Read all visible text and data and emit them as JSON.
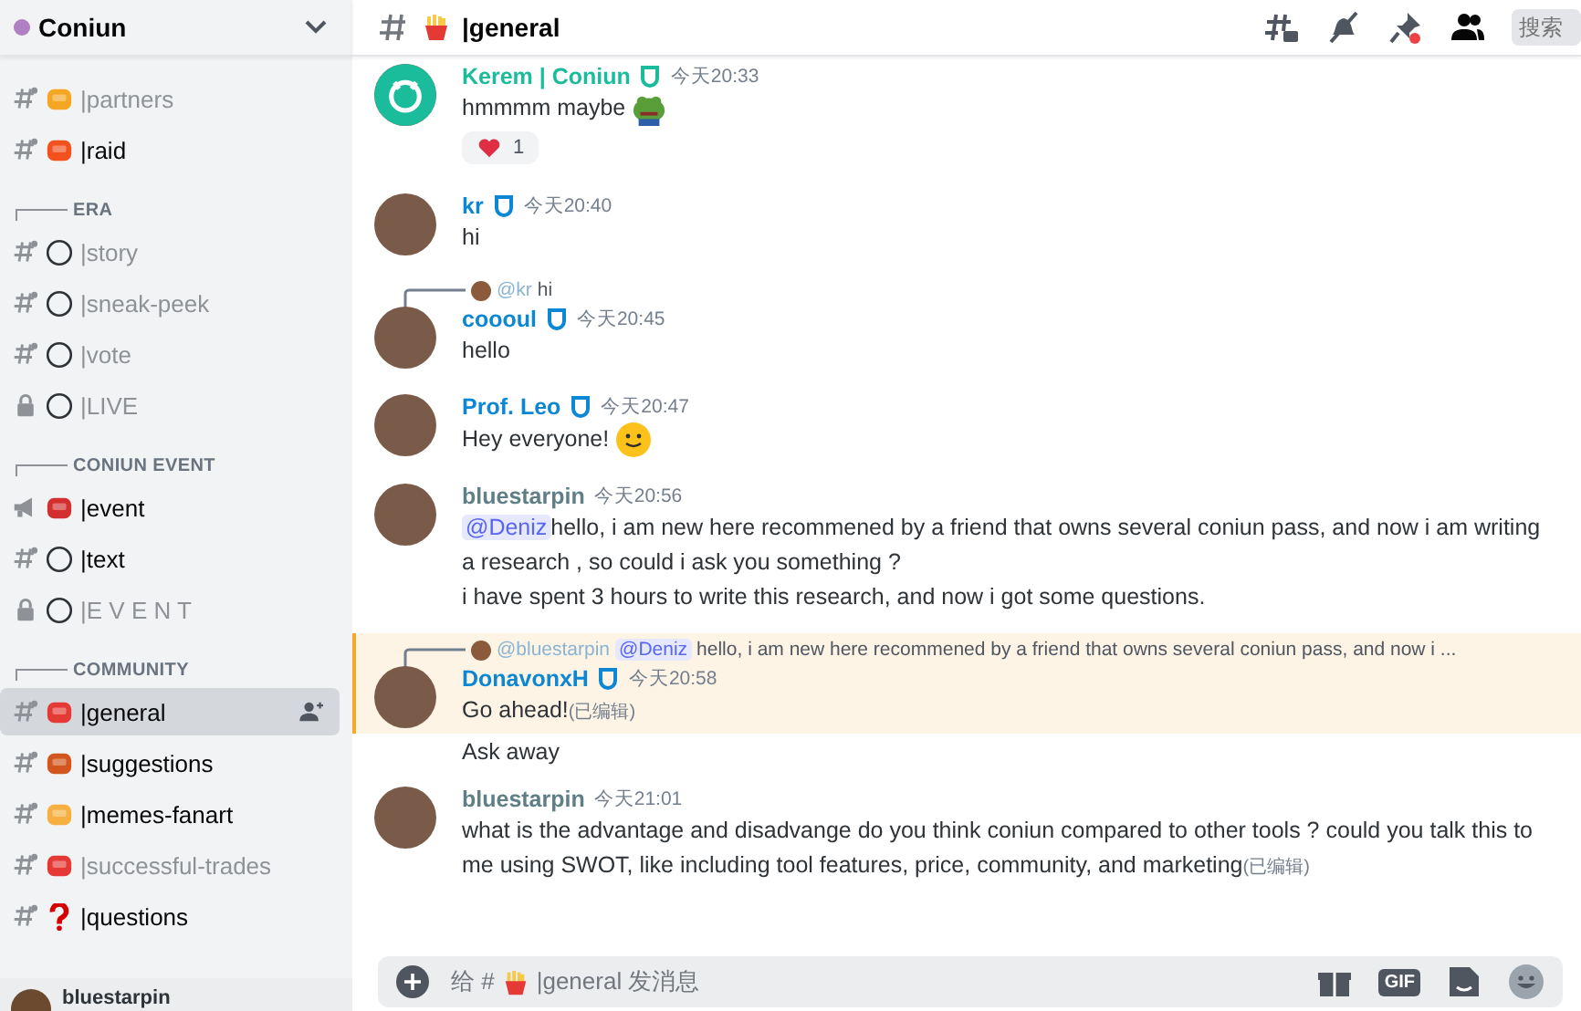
{
  "server": {
    "name": "Coniun"
  },
  "sidebar": {
    "groups": [
      {
        "channels": [
          {
            "kind": "hash",
            "emoji": {
              "kind": "beer"
            },
            "name": "|partners",
            "unread": false,
            "selected": false
          },
          {
            "kind": "hash",
            "emoji": {
              "kind": "fire"
            },
            "name": "|raid",
            "unread": true,
            "selected": false
          }
        ]
      },
      {
        "title": "ERA",
        "expanded": true,
        "channels": [
          {
            "kind": "hash",
            "emoji": {
              "kind": "circle"
            },
            "name": "|story",
            "unread": false,
            "selected": false
          },
          {
            "kind": "hash",
            "emoji": {
              "kind": "circle"
            },
            "name": "|sneak-peek",
            "unread": false,
            "selected": false
          },
          {
            "kind": "hash",
            "emoji": {
              "kind": "circle"
            },
            "name": "|vote",
            "unread": false,
            "selected": false
          },
          {
            "kind": "lock",
            "emoji": {
              "kind": "circle"
            },
            "name": "|LIVE",
            "unread": false,
            "selected": false
          }
        ]
      },
      {
        "title": "CONIUN EVENT",
        "expanded": true,
        "channels": [
          {
            "kind": "megaphone",
            "emoji": {
              "kind": "megaphone"
            },
            "name": "|event",
            "unread": true,
            "selected": false
          },
          {
            "kind": "hash",
            "emoji": {
              "kind": "circle"
            },
            "name": "|text",
            "unread": true,
            "selected": false
          },
          {
            "kind": "lock",
            "emoji": {
              "kind": "circle"
            },
            "name": "|E V E N T",
            "unread": false,
            "selected": false
          }
        ]
      },
      {
        "title": "COMMUNITY",
        "expanded": true,
        "channels": [
          {
            "kind": "hash",
            "emoji": {
              "kind": "fries"
            },
            "name": "|general",
            "unread": true,
            "selected": true
          },
          {
            "kind": "hash",
            "emoji": {
              "kind": "brick"
            },
            "name": "|suggestions",
            "unread": true,
            "selected": false
          },
          {
            "kind": "hash",
            "emoji": {
              "kind": "cat"
            },
            "name": "|memes-fanart",
            "unread": true,
            "selected": false
          },
          {
            "kind": "hash",
            "emoji": {
              "kind": "target"
            },
            "name": "|successful-trades",
            "unread": false,
            "selected": false
          },
          {
            "kind": "hash",
            "emoji": {
              "kind": "question"
            },
            "name": "|questions",
            "unread": true,
            "selected": false
          }
        ]
      }
    ]
  },
  "user_bar": {
    "name": "bluestarpin"
  },
  "header": {
    "channel": "|general",
    "search": {
      "placeholder": "搜索"
    }
  },
  "messages": [
    {
      "author": "Kerem | Coniun",
      "color": "#1abc9c",
      "badge": true,
      "time": "今天20:33",
      "avatar": {
        "kind": "logo"
      },
      "highlighted": false,
      "lines": [
        {
          "text": "hmmmm maybe",
          "emoji": {
            "kind": "frog"
          }
        }
      ],
      "reaction": {
        "count": "1"
      }
    },
    {
      "author": "kr",
      "color": "#0b87d4",
      "badge": true,
      "time": "今天20:40",
      "avatar": {
        "kind": "photo"
      },
      "highlighted": false,
      "lines": [
        {
          "text": "hi"
        }
      ]
    },
    {
      "author": "coooul",
      "color": "#0b87d4",
      "badge": true,
      "time": "今天20:45",
      "avatar": {
        "kind": "photo"
      },
      "highlighted": false,
      "reply": {
        "author": "@kr",
        "text": "hi"
      },
      "lines": [
        {
          "text": "hello"
        }
      ]
    },
    {
      "author": "Prof. Leo",
      "color": "#0b87d4",
      "badge": true,
      "time": "今天20:47",
      "avatar": {
        "kind": "photo"
      },
      "highlighted": false,
      "lines": [
        {
          "text": "Hey everyone!",
          "emoji": {
            "kind": "smile"
          }
        }
      ]
    },
    {
      "author": "bluestarpin",
      "color": "#5e7f86",
      "badge": false,
      "time": "今天20:56",
      "avatar": {
        "kind": "photo"
      },
      "highlighted": false,
      "lines": [
        {
          "mention": "@Deniz",
          "text": "hello, i am new here recommened by a friend that owns several coniun pass,  and now i am writing a research ,  so could i ask you something ?"
        },
        {
          "text": "i have spent 3 hours to write this research, and now i got some questions."
        }
      ]
    },
    {
      "author": "DonavonxH",
      "color": "#0b87d4",
      "badge": true,
      "time": "今天20:58",
      "avatar": {
        "kind": "photo"
      },
      "highlighted": true,
      "reply": {
        "author": "@bluestarpin",
        "mention": "@Deniz",
        "text": "hello, i am new here recommened by a friend that owns several coniun pass,  and now i ..."
      },
      "lines": [
        {
          "text": "Go ahead!",
          "edited": "(已编辑)"
        }
      ],
      "followups": [
        "Ask away"
      ]
    },
    {
      "author": "bluestarpin",
      "color": "#5e7f86",
      "badge": false,
      "time": "今天21:01",
      "avatar": {
        "kind": "photo"
      },
      "highlighted": false,
      "lines": [
        {
          "text": "what is the advantage and disadvange do you think coniun compared to other tools ?  could you talk this to me using SWOT, like including tool features, price, community, and marketing",
          "edited": "(已编辑)"
        }
      ]
    }
  ],
  "composer": {
    "placeholder_parts": [
      "给 #",
      "|general 发消息"
    ],
    "gif": "GIF"
  }
}
